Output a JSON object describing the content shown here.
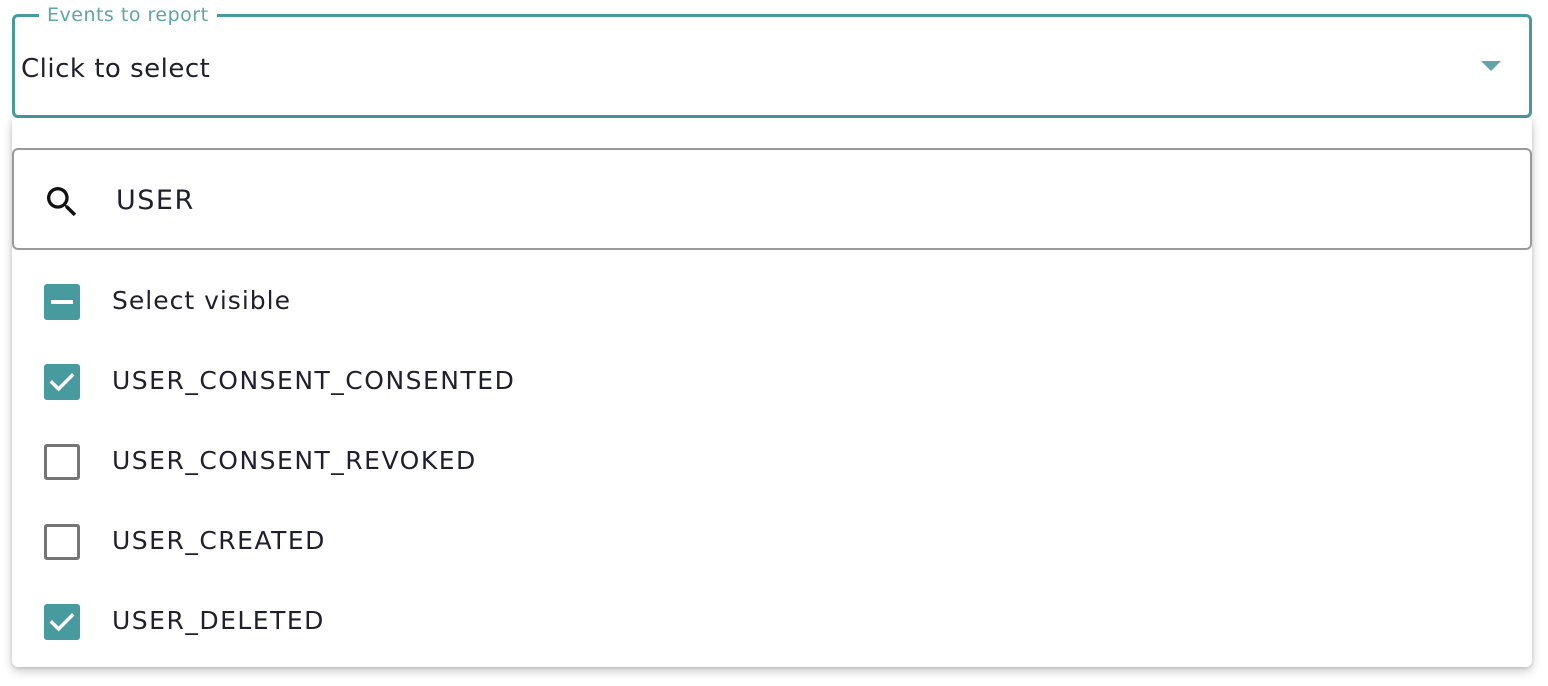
{
  "select": {
    "legend": "Events to report",
    "value": "Click to select",
    "caret_icon": "chevron-down-icon"
  },
  "search": {
    "icon": "search-icon",
    "value": "USER"
  },
  "select_visible": {
    "label": "Select visible",
    "state": "indeterminate"
  },
  "options": [
    {
      "label": "USER_CONSENT_CONSENTED",
      "checked": true
    },
    {
      "label": "USER_CONSENT_REVOKED",
      "checked": false
    },
    {
      "label": "USER_CREATED",
      "checked": false
    },
    {
      "label": "USER_DELETED",
      "checked": true
    }
  ],
  "colors": {
    "accent": "#479a9d",
    "legend": "#5fa4a7",
    "checkbox_border": "#757575",
    "text": "#1f1f2e"
  }
}
